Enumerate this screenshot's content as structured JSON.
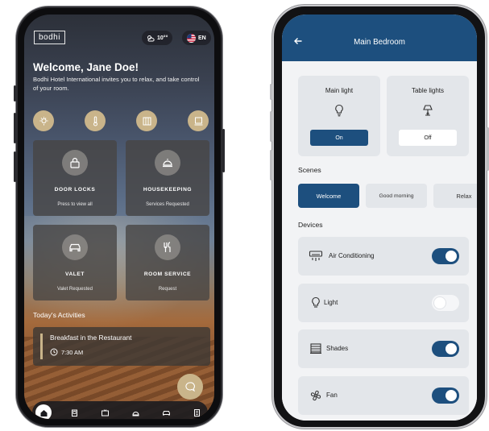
{
  "colors": {
    "gold": "#c9b48a",
    "navy": "#1d4f7e",
    "card_bg": "#e3e6ea"
  },
  "left": {
    "brand": "bodhi",
    "weather": {
      "icon": "partly-cloudy-icon",
      "temp": "10°°"
    },
    "language": {
      "icon": "us-flag-icon",
      "code": "EN"
    },
    "welcome": "Welcome, Jane Doe!",
    "subtitle": "Bodhi Hotel International invites you to relax, and take control of your room.",
    "quick_icons": [
      "lightbulb-icon",
      "thermometer-icon",
      "curtains-icon",
      "shade-icon"
    ],
    "cards": [
      {
        "title": "DOOR LOCKS",
        "subtitle": "Press to view all",
        "icon": "lock-icon"
      },
      {
        "title": "HOUSEKEEPING",
        "subtitle": "Services Requested",
        "icon": "bell-icon"
      },
      {
        "title": "VALET",
        "subtitle": "Valet Requested",
        "icon": "car-icon"
      },
      {
        "title": "ROOM SERVICE",
        "subtitle": "Request",
        "icon": "utensils-icon"
      }
    ],
    "activities_title": "Today's Activities",
    "activity": {
      "title": "Breakfast in the Restaurant",
      "time": "7:30 AM"
    },
    "nav": [
      "home-icon",
      "door-icon",
      "tv-icon",
      "bell-icon",
      "car-icon",
      "building-icon"
    ]
  },
  "right": {
    "title": "Main Bedroom",
    "lights": [
      {
        "name": "Main light",
        "state": "On",
        "icon": "bulb-icon"
      },
      {
        "name": "Table lights",
        "state": "Off",
        "icon": "table-lamp-icon"
      }
    ],
    "scenes_label": "Scenes",
    "scenes": [
      "Welcome",
      "Good morning",
      "Relax"
    ],
    "devices_label": "Devices",
    "devices": [
      {
        "name": "Air Conditioning",
        "on": true,
        "icon": "air-conditioner-icon"
      },
      {
        "name": "Light",
        "on": false,
        "icon": "bulb-icon"
      },
      {
        "name": "Shades",
        "on": true,
        "icon": "shades-icon"
      },
      {
        "name": "Fan",
        "on": true,
        "icon": "fan-icon"
      }
    ]
  }
}
